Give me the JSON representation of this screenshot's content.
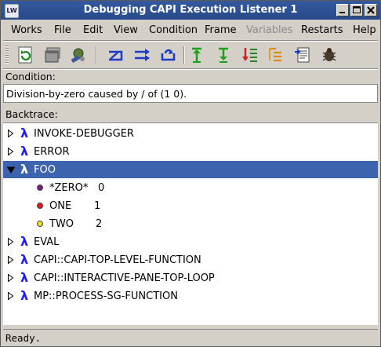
{
  "window": {
    "title": "Debugging CAPI Execution Listener 1",
    "app_icon_text": "LW"
  },
  "menubar": [
    "Works",
    "File",
    "Edit",
    "View",
    "Condition",
    "Frame",
    "Variables",
    "Restarts",
    "Help"
  ],
  "menubar_disabled": [
    "Variables"
  ],
  "toolbar": {
    "buttons": [
      "refresh-icon",
      "windows-icon",
      "tools-icon",
      "restart-icon",
      "continue-icon",
      "return-icon",
      "up-frame-icon",
      "down-frame-icon",
      "bottom-frame-icon",
      "top-frame-icon",
      "report-icon",
      "bug-icon"
    ]
  },
  "condition": {
    "label": "Condition:",
    "text": "Division-by-zero caused by / of (1 0)."
  },
  "backtrace": {
    "label": "Backtrace:",
    "frames": [
      {
        "name": "INVOKE-DEBUGGER",
        "expanded": false,
        "selected": false
      },
      {
        "name": "ERROR",
        "expanded": false,
        "selected": false
      },
      {
        "name": "FOO",
        "expanded": true,
        "selected": true,
        "variables": [
          {
            "name": "*ZERO*",
            "value": "0",
            "color": "#7a1f7a"
          },
          {
            "name": "ONE",
            "value": "1",
            "color": "#e01818"
          },
          {
            "name": "TWO",
            "value": "2",
            "color": "#f0e020"
          }
        ]
      },
      {
        "name": "EVAL",
        "expanded": false,
        "selected": false
      },
      {
        "name": "CAPI::CAPI-TOP-LEVEL-FUNCTION",
        "expanded": false,
        "selected": false
      },
      {
        "name": "CAPI::INTERACTIVE-PANE-TOP-LOOP",
        "expanded": false,
        "selected": false
      },
      {
        "name": "MP::PROCESS-SG-FUNCTION",
        "expanded": false,
        "selected": false
      }
    ]
  },
  "status": {
    "text": "Ready."
  },
  "lambda_glyph": "λ"
}
